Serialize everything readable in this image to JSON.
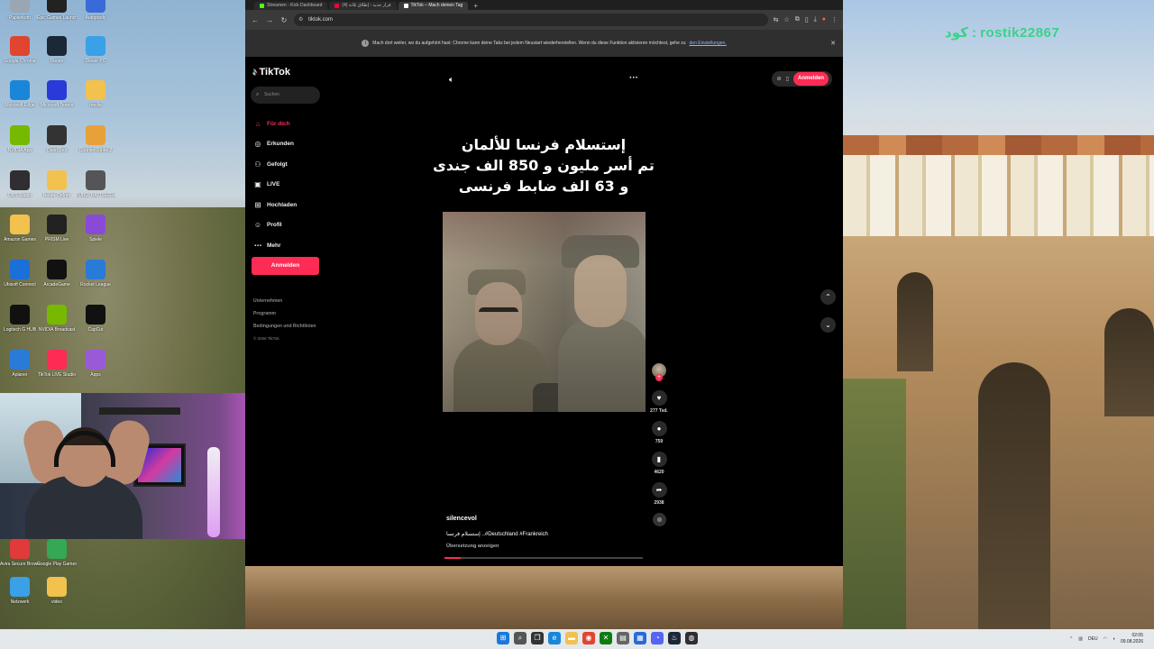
{
  "desktop": {
    "watermark": "كود : rostik22867",
    "icons_col1": [
      {
        "label": "Papierkorb",
        "icon": "recycle-bin-icon",
        "color": "#9aa6b2"
      },
      {
        "label": "Google Chrome",
        "icon": "chrome-icon",
        "color": "#e0452f"
      },
      {
        "label": "Microsoft Edge",
        "icon": "edge-icon",
        "color": "#1a86d8"
      },
      {
        "label": "NVIDIA App",
        "icon": "nvidia-icon",
        "color": "#76b900"
      },
      {
        "label": "OBS Studio",
        "icon": "obs-icon",
        "color": "#302e31"
      },
      {
        "label": "Amazon Games",
        "icon": "folder-icon",
        "color": "#f2c14e"
      },
      {
        "label": "Ubisoft Connect",
        "icon": "ubisoft-icon",
        "color": "#1b6fd8"
      },
      {
        "label": "Logitech G HUB",
        "icon": "logitech-icon",
        "color": "#111111"
      },
      {
        "label": "Aplaner",
        "icon": "app-icon",
        "color": "#2a7ad8"
      }
    ],
    "icons_col2": [
      {
        "label": "Epic Games Launcher",
        "icon": "epic-games-icon",
        "color": "#222222"
      },
      {
        "label": "Steam",
        "icon": "steam-icon",
        "color": "#1b2838"
      },
      {
        "label": "Microsoft Teams",
        "icon": "teams-icon",
        "color": "#2a3ad8"
      },
      {
        "label": "OpenShot",
        "icon": "openshot-icon",
        "color": "#333333"
      },
      {
        "label": "Neuer Ordner",
        "icon": "folder-icon",
        "color": "#f2c14e"
      },
      {
        "label": "PRISM Live",
        "icon": "prism-icon",
        "color": "#222222"
      },
      {
        "label": "ArcadeGame",
        "icon": "app-icon",
        "color": "#111111"
      },
      {
        "label": "NVIDIA Broadcast",
        "icon": "nvidia-broadcast-icon",
        "color": "#76b900"
      },
      {
        "label": "TikTok LIVE Studio",
        "icon": "tiktok-icon",
        "color": "#fe2c55"
      }
    ],
    "icons_col3": [
      {
        "label": "Autopredy",
        "icon": "app-icon",
        "color": "#3a6ad8"
      },
      {
        "label": "Dieser PC",
        "icon": "computer-icon",
        "color": "#3aa0e8"
      },
      {
        "label": "media",
        "icon": "folder-icon",
        "color": "#f2c14e"
      },
      {
        "label": "Counter-Strike 2",
        "icon": "cs2-icon",
        "color": "#e8a03a"
      },
      {
        "label": "PUBG: BATTLEGROUNDS",
        "icon": "pubg-icon",
        "color": "#555555"
      },
      {
        "label": "Spiele",
        "icon": "game-icon",
        "color": "#8a4ad8"
      },
      {
        "label": "Rocket League",
        "icon": "rocket-league-icon",
        "color": "#2a7ad8"
      },
      {
        "label": "CapCut",
        "icon": "capcut-icon",
        "color": "#111111"
      },
      {
        "label": "Apps",
        "icon": "app-icon",
        "color": "#9a5ad8"
      }
    ],
    "icons_bottom": [
      {
        "label": "Avira Secure Browser",
        "icon": "avira-icon",
        "color": "#e03a3a"
      },
      {
        "label": "Google Play Games",
        "icon": "play-games-icon",
        "color": "#34a853"
      },
      {
        "label": "Netzwerk",
        "icon": "network-icon",
        "color": "#3aa0e8"
      },
      {
        "label": "video",
        "icon": "folder-icon",
        "color": "#f2c14e"
      }
    ]
  },
  "browser": {
    "tabs": [
      {
        "label": "Streamen - Kick Dashboard",
        "color": "#53fc18"
      },
      {
        "label": "(4) قرار جديد - إطلاق ثلاثة",
        "color": "#ff0033"
      },
      {
        "label": "TikTok – Mach deinen Tag",
        "color": "#ffffff"
      }
    ],
    "url": "tiktok.com",
    "infobar_text": "Mach dort weiter, wo du aufgehört hast: Chrome kann deine Tabs bei jedem Neustart wiederherstellen. Wenn du diese Funktion aktivieren möchtest, gehe zu",
    "infobar_link": "den Einstellungen."
  },
  "tiktok": {
    "logo": "TikTok",
    "search_placeholder": "Suchen",
    "nav": [
      {
        "label": "Für dich",
        "icon": "home-icon",
        "glyph": "⌂",
        "active": true
      },
      {
        "label": "Erkunden",
        "icon": "compass-icon",
        "glyph": "◎",
        "active": false
      },
      {
        "label": "Gefolgt",
        "icon": "following-icon",
        "glyph": "⚇",
        "active": false
      },
      {
        "label": "LIVE",
        "icon": "live-icon",
        "glyph": "▣",
        "active": false
      },
      {
        "label": "Hochladen",
        "icon": "upload-icon",
        "glyph": "⊞",
        "active": false
      },
      {
        "label": "Profil",
        "icon": "profile-icon",
        "glyph": "☺",
        "active": false
      },
      {
        "label": "Mehr",
        "icon": "more-icon",
        "glyph": "⋯",
        "active": false
      }
    ],
    "login_label": "Anmelden",
    "footer_links": [
      "Unternehmen",
      "Programm",
      "Bedingungen und Richtlinien"
    ],
    "copyright": "© 2026 TikTok",
    "header_login": "Anmelden",
    "headline": "إستسلام فرنسا للألمان\nتم أسر مليون و 850 الف جندى\nو 63 الف ضابط فرنسى",
    "counts": {
      "likes": "277 Tsd.",
      "comments": "759",
      "saves": "4620",
      "shares": "2938"
    },
    "creator": "silencevol",
    "description": "إستسلام فرنسا ..#Deutschland #Frankreich",
    "translate_label": "Übersetzung anzeigen",
    "progress": 0.08,
    "accent": "#fe2c55"
  },
  "taskbar": {
    "apps": [
      {
        "icon": "windows-start-icon",
        "glyph": "⊞",
        "color": "#1a78d8"
      },
      {
        "icon": "search-icon",
        "glyph": "⌕",
        "color": "#555555"
      },
      {
        "icon": "task-view-icon",
        "glyph": "❐",
        "color": "#333333"
      },
      {
        "icon": "edge-icon",
        "glyph": "e",
        "color": "#1a86d8"
      },
      {
        "icon": "file-explorer-icon",
        "glyph": "▬",
        "color": "#f2c14e"
      },
      {
        "icon": "chrome-icon",
        "glyph": "◉",
        "color": "#e0452f"
      },
      {
        "icon": "xbox-icon",
        "glyph": "✕",
        "color": "#107c10"
      },
      {
        "icon": "notepad-icon",
        "glyph": "▤",
        "color": "#666666"
      },
      {
        "icon": "ms-store-icon",
        "glyph": "▦",
        "color": "#2a6ad8"
      },
      {
        "icon": "discord-icon",
        "glyph": "◔",
        "color": "#5865f2"
      },
      {
        "icon": "steam-icon",
        "glyph": "♨",
        "color": "#1b2838"
      },
      {
        "icon": "obs-icon",
        "glyph": "◍",
        "color": "#302e31"
      }
    ],
    "lang": "DEU",
    "time": "02:05",
    "date": "09.08.2026"
  }
}
